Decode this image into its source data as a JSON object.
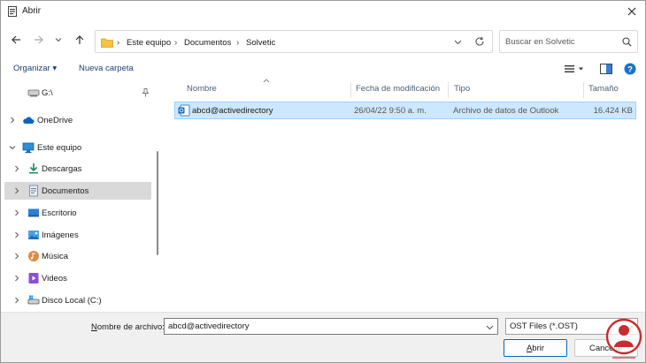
{
  "window": {
    "title": "Abrir"
  },
  "address": {
    "crumbs": [
      "Este equipo",
      "Documentos",
      "Solvetic"
    ]
  },
  "search": {
    "placeholder": "Buscar en Solvetic"
  },
  "commands": {
    "organize": "Organizar ▾",
    "new_folder": "Nueva carpeta"
  },
  "sidebar": {
    "items": [
      {
        "label": "G:\\",
        "icon": "drive-icon"
      },
      {
        "label": "OneDrive",
        "icon": "cloud-icon"
      },
      {
        "label": "Este equipo",
        "icon": "computer-icon"
      },
      {
        "label": "Descargas",
        "icon": "download-icon"
      },
      {
        "label": "Documentos",
        "icon": "documents-icon"
      },
      {
        "label": "Escritorio",
        "icon": "desktop-icon"
      },
      {
        "label": "Imágenes",
        "icon": "pictures-icon"
      },
      {
        "label": "Música",
        "icon": "music-icon"
      },
      {
        "label": "Videos",
        "icon": "videos-icon"
      },
      {
        "label": "Disco Local (C:)",
        "icon": "local-disk-icon"
      }
    ],
    "selected": "Documentos"
  },
  "table": {
    "columns": [
      "Nombre",
      "Fecha de modificación",
      "Tipo",
      "Tamaño"
    ],
    "rows": [
      {
        "name": "abcd@activedirectory",
        "date": "26/04/22 9:50 a. m.",
        "type": "Archivo de datos de Outlook",
        "size": "16.424 KB"
      }
    ]
  },
  "footer": {
    "filename_label_pre": "",
    "filename_label_underlined": "N",
    "filename_label_post": "ombre de archivo:",
    "filename_value": "abcd@activedirectory",
    "file_type": "OST Files (*.OST)",
    "open_underlined": "A",
    "open_rest": "brir",
    "cancel": "Cancelar"
  },
  "colors": {
    "accent": "#0067c0",
    "selection": "#cce8ff",
    "folder": "#f5c242",
    "help": "#1a73c8"
  }
}
